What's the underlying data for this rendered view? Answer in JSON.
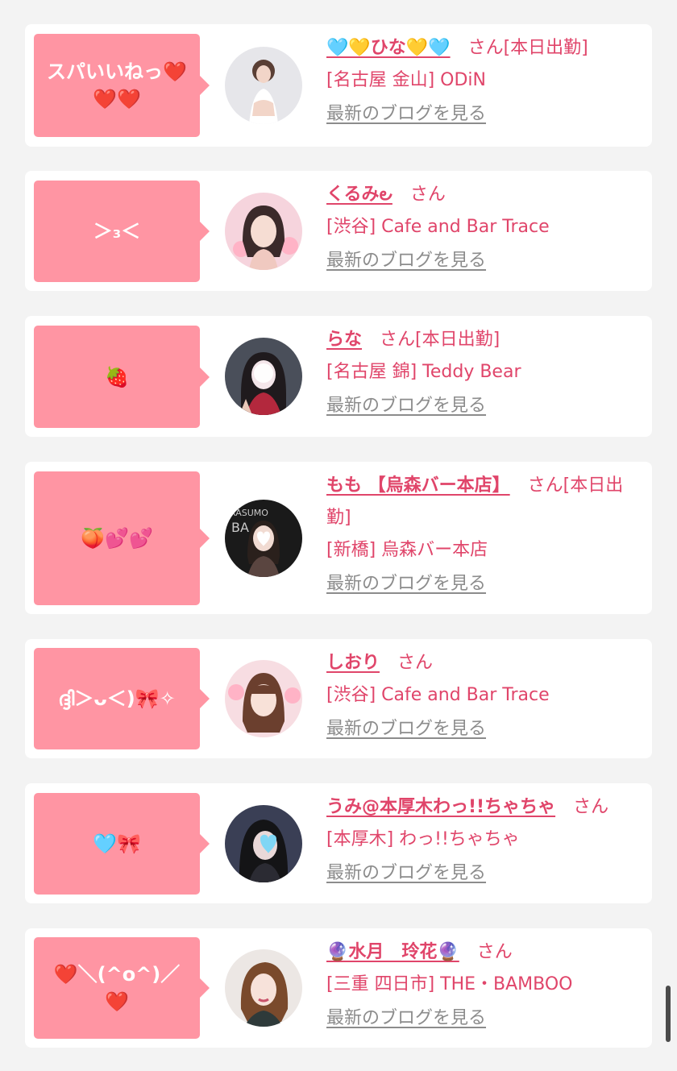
{
  "blog_link_label": "最新のブログを見る",
  "cards": [
    {
      "bubble": "スパいいねっ❤️\n❤️❤️",
      "name": "🩵💛ひな💛🩵",
      "suffix": "さん[本日出勤]",
      "shop": "[名古屋 金山] ODiN",
      "avatar_icon": "girl-photo"
    },
    {
      "bubble": "＞₃＜",
      "name": "くるみ౿",
      "suffix": "さん",
      "shop": "[渋谷] Cafe and Bar Trace",
      "avatar_icon": "girl-photo"
    },
    {
      "bubble": "🍓",
      "name": "らな",
      "suffix": "さん[本日出勤]",
      "shop": "[名古屋 錦] Teddy Bear",
      "avatar_icon": "girl-photo"
    },
    {
      "bubble": "🍑💕💕",
      "name": "もも 【烏森バー本店】",
      "suffix": "さん[本日出勤]",
      "shop": "[新橋] 烏森バー本店",
      "avatar_icon": "girl-photo"
    },
    {
      "bubble": "ദ്ദി＞ᴗ＜)🎀✧",
      "name": "しおり",
      "suffix": "さん",
      "shop": "[渋谷] Cafe and Bar Trace",
      "avatar_icon": "girl-photo"
    },
    {
      "bubble": "🩵🎀",
      "name": "うみ@本厚木わっ!!ちゃちゃ",
      "suffix": "さん",
      "shop": "[本厚木] わっ!!ちゃちゃ",
      "avatar_icon": "girl-photo"
    },
    {
      "bubble": "❤️＼(^o^)／❤️",
      "name": "🔮水月　玲花🔮",
      "suffix": "さん",
      "shop": "[三重 四日市] THE・BAMBOO",
      "avatar_icon": "girl-photo"
    }
  ],
  "colors": {
    "page_bg": "#f3f3f3",
    "bubble_bg": "#ff95a3",
    "accent": "#e0456a",
    "link_gray": "#8c8c8c"
  }
}
